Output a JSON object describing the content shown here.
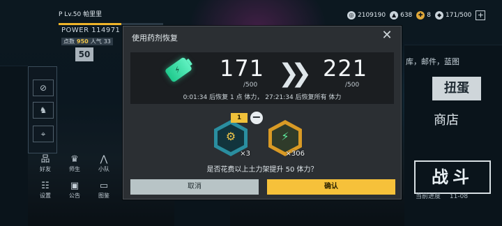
{
  "hud": {
    "player_name": "P  Lv.50 帕里里",
    "power_label": "POWER",
    "power_value": "114971",
    "score_label": "点数",
    "score_value": "950",
    "popularity_label": "人气",
    "popularity_value": "33",
    "level_badge": "50",
    "level_progress": 0.6,
    "colors": {
      "accent": "#f0b429"
    }
  },
  "currency": {
    "coins": "2109190",
    "gems": "638",
    "tickets": "8",
    "stamina": "171/500",
    "add_label": "+"
  },
  "bottom_grid": [
    {
      "icon": "friends-icon",
      "glyph": "品",
      "label": "好友"
    },
    {
      "icon": "academy-icon",
      "glyph": "♛",
      "label": "师生"
    },
    {
      "icon": "team-icon",
      "glyph": "⋀",
      "label": "小队"
    },
    {
      "icon": "settings-icon",
      "glyph": "☷",
      "label": "设置"
    },
    {
      "icon": "notice-icon",
      "glyph": "▣",
      "label": "公告"
    },
    {
      "icon": "gallery-icon",
      "glyph": "▭",
      "label": "图鉴"
    }
  ],
  "right_menu": {
    "links": "库，邮件，蓝图",
    "gacha": "扭蛋",
    "shop": "商店",
    "battle": "战斗",
    "progress_label": "当前进度",
    "progress_value": "11-08"
  },
  "dialog": {
    "title": "使用药剂恢复",
    "current_stamina": "171",
    "max_stamina": "/500",
    "new_stamina": "221",
    "new_max": "/500",
    "recover_text": "0:01:34 后恢复 1 点 体力， 27:21:34 后恢复所有 体力",
    "selected_qty": "1",
    "items": [
      {
        "icon": "potion-small-icon",
        "count": "×3",
        "color": "#1d8f86"
      },
      {
        "icon": "potion-large-icon",
        "count": "×306",
        "color": "#d99a25"
      }
    ],
    "question": "是否花费以上土力架提升 50 体力？",
    "cancel_label": "取消",
    "confirm_label": "确认"
  }
}
